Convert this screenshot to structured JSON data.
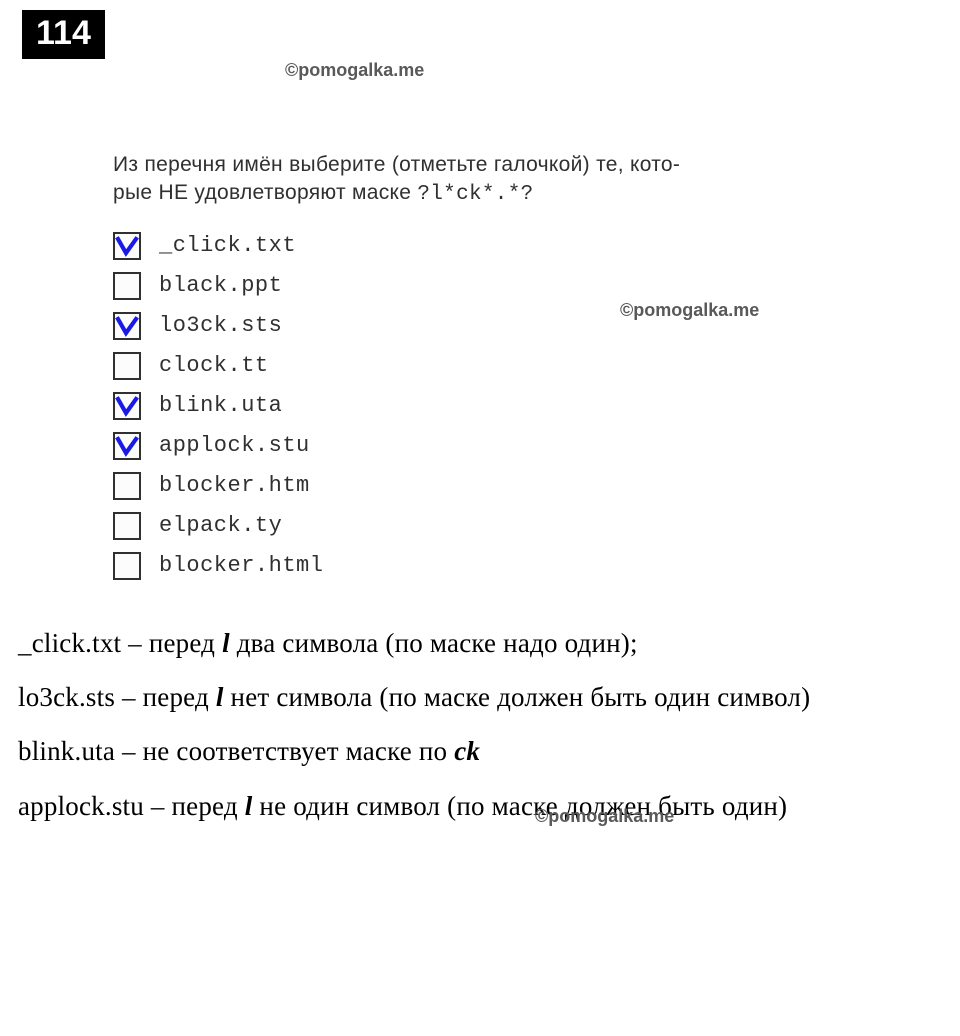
{
  "task_number": "114",
  "watermark": "©pomogalka.me",
  "question": {
    "line1": "Из перечня имён выберите (отметьте галочкой) те, кото-",
    "line2_prefix": "рые НЕ удовлетворяют маске ",
    "mask": "?l*ck*.*?"
  },
  "options": [
    {
      "label": "_click.txt",
      "checked": true
    },
    {
      "label": "black.ppt",
      "checked": false
    },
    {
      "label": "lo3ck.sts",
      "checked": true
    },
    {
      "label": "clock.tt",
      "checked": false
    },
    {
      "label": "blink.uta",
      "checked": true
    },
    {
      "label": "applock.stu",
      "checked": true
    },
    {
      "label": "blocker.htm",
      "checked": false
    },
    {
      "label": "elpack.ty",
      "checked": false
    },
    {
      "label": "blocker.html",
      "checked": false
    }
  ],
  "explanations": [
    {
      "prefix": "_click.txt – перед ",
      "em": "l",
      "suffix": " два символа (по маске надо один);"
    },
    {
      "prefix": "lo3ck.sts – перед ",
      "em": "l",
      "suffix": " нет символа (по маске должен быть один символ)"
    },
    {
      "prefix": "blink.uta – не соответствует маске по ",
      "em": "ck",
      "suffix": ""
    },
    {
      "prefix": "applock.stu – перед ",
      "em": "l",
      "suffix": "  не один символ (по маске должен быть один)"
    }
  ]
}
